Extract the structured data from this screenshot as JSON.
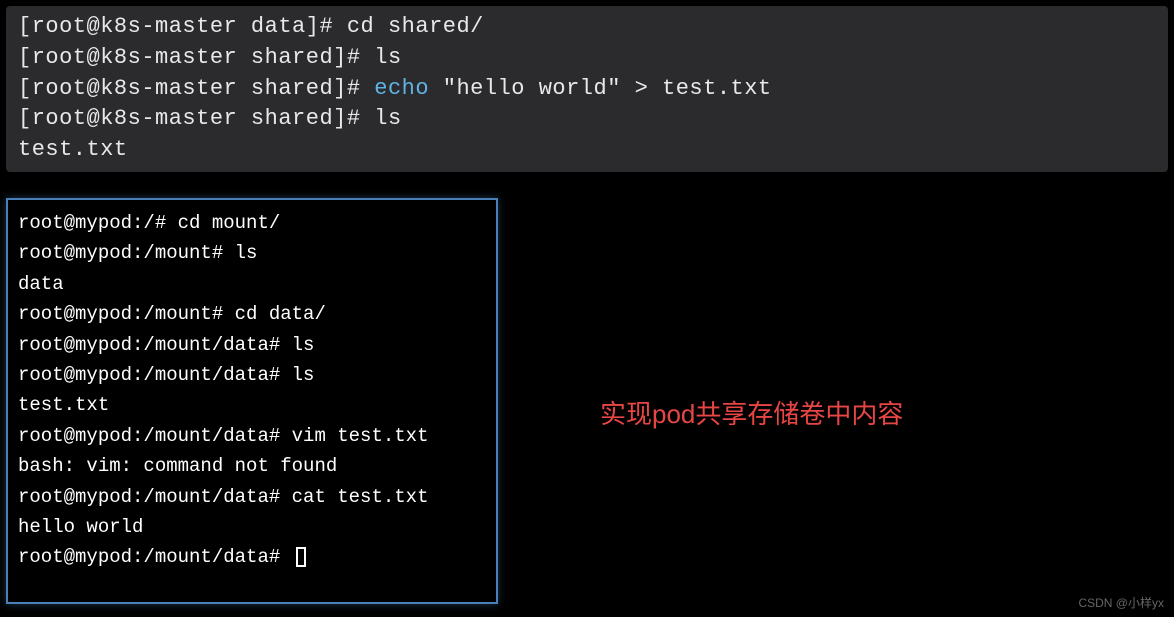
{
  "top_terminal": {
    "lines": [
      {
        "prompt": "[root@k8s-master data]# ",
        "cmd": "cd shared/",
        "highlight": false
      },
      {
        "prompt": "[root@k8s-master shared]# ",
        "cmd": "ls",
        "highlight": false
      },
      {
        "prompt": "[root@k8s-master shared]# ",
        "cmd_pre": "echo",
        "cmd_post": " \"hello world\" > test.txt",
        "highlight": true
      },
      {
        "prompt": "[root@k8s-master shared]# ",
        "cmd": "ls",
        "highlight": false
      },
      {
        "output": "test.txt"
      }
    ]
  },
  "bottom_terminal": {
    "lines": [
      "root@mypod:/# cd mount/",
      "root@mypod:/mount# ls",
      "data",
      "root@mypod:/mount# cd data/",
      "root@mypod:/mount/data# ls",
      "root@mypod:/mount/data# ls",
      "test.txt",
      "root@mypod:/mount/data# vim test.txt",
      "bash: vim: command not found",
      "root@mypod:/mount/data# cat test.txt",
      "hello world",
      "root@mypod:/mount/data# "
    ],
    "show_cursor_on_last": true
  },
  "annotation": "实现pod共享存储卷中内容",
  "watermark": "CSDN @小样yx"
}
